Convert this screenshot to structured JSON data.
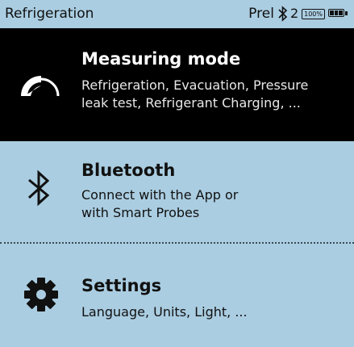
{
  "status_bar": {
    "title": "Refrigeration",
    "mode_label": "Prel",
    "bluetooth_icon": "bluetooth-icon",
    "bluetooth_count": "2",
    "battery_percent": "100%",
    "battery_icon": "battery-full-icon"
  },
  "menu": {
    "items": [
      {
        "title": "Measuring mode",
        "description": "Refrigeration, Evacuation, Pressure\nleak test, Refrigerant Charging, ...",
        "icon": "gauge-icon",
        "selected": true
      },
      {
        "title": "Bluetooth",
        "description": "Connect with the App or\nwith Smart Probes",
        "icon": "bluetooth-icon",
        "selected": false
      },
      {
        "title": "Settings",
        "description": "Language, Units, Light, ...",
        "icon": "gear-icon",
        "selected": false
      }
    ]
  },
  "colors": {
    "background": "#aacde1",
    "selected_background": "#000000",
    "selected_text": "#ffffff",
    "text": "#111111"
  }
}
